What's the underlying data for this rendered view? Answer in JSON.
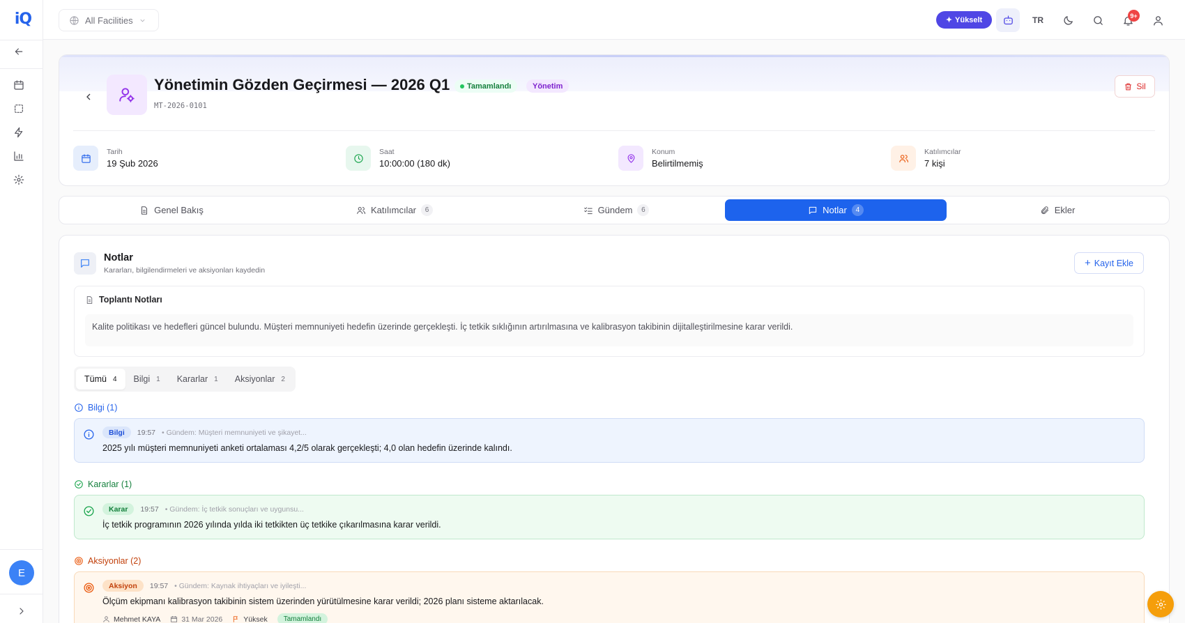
{
  "brand": {
    "logo_text": "iQ"
  },
  "topbar": {
    "facility_label": "All Facilities",
    "upgrade_label": "Yükselt",
    "language": "TR",
    "notifications_badge": "9+"
  },
  "sidebar": {
    "items": [
      "back-arrow-icon",
      "calendar-icon",
      "dashed-square-icon",
      "zap-icon",
      "bar-chart-icon",
      "settings-icon"
    ],
    "avatar_initial": "E"
  },
  "meeting": {
    "title": "Yönetimin Gözden Geçirmesi — 2026 Q1",
    "status_badge": "Tamamlandı",
    "category_badge": "Yönetim",
    "code": "MT-2026-0101",
    "delete_label": "Sil",
    "info": [
      {
        "label": "Tarih",
        "value": "19 Şub 2026",
        "icon": "calendar-icon",
        "bg": "#e6eefc",
        "color": "#2563eb"
      },
      {
        "label": "Saat",
        "value": "10:00:00 (180 dk)",
        "icon": "clock-icon",
        "bg": "#e7f7ee",
        "color": "#16a34a"
      },
      {
        "label": "Konum",
        "value": "Belirtilmemiş",
        "icon": "map-pin-icon",
        "bg": "#f3e8ff",
        "color": "#9333ea"
      },
      {
        "label": "Katılımcılar",
        "value": "7 kişi",
        "icon": "users-icon",
        "bg": "#fff1e6",
        "color": "#ea580c"
      }
    ]
  },
  "tabs": [
    {
      "label": "Genel Bakış",
      "count": "",
      "icon": "document-icon"
    },
    {
      "label": "Katılımcılar",
      "count": "6",
      "icon": "users-icon"
    },
    {
      "label": "Gündem",
      "count": "6",
      "icon": "list-check-icon"
    },
    {
      "label": "Notlar",
      "count": "4",
      "icon": "message-icon",
      "active": true
    },
    {
      "label": "Ekler",
      "count": "",
      "icon": "paperclip-icon"
    }
  ],
  "notes": {
    "title": "Notlar",
    "subtitle": "Kararları, bilgilendirmeleri ve aksiyonları kaydedin",
    "add_label": "Kayıt Ekle",
    "minutes_title": "Toplantı Notları",
    "minutes_text": "Kalite politikası ve hedefleri güncel bulundu. Müşteri memnuniyeti hedefin üzerinde gerçekleşti. İç tetkik sıklığının artırılmasına ve kalibrasyon takibinin dijitalleştirilmesine karar verildi.",
    "filters": [
      {
        "label": "Tümü",
        "count": "4",
        "active": true
      },
      {
        "label": "Bilgi",
        "count": "1"
      },
      {
        "label": "Kararlar",
        "count": "1"
      },
      {
        "label": "Aksiyonlar",
        "count": "2"
      }
    ],
    "sections": {
      "info": {
        "heading": "Bilgi (1)",
        "tag": "Bilgi",
        "time": "19:57",
        "agenda": "• Gündem: Müşteri memnuniyeti ve şikayet...",
        "text": "2025 yılı müşteri memnuniyeti anketi ortalaması 4,2/5 olarak gerçekleşti; 4,0 olan hedefin üzerinde kalındı."
      },
      "decisions": {
        "heading": "Kararlar (1)",
        "tag": "Karar",
        "time": "19:57",
        "agenda": "• Gündem: İç tetkik sonuçları ve uygunsu...",
        "text": "İç tetkik programının 2026 yılında yılda iki tetkikten üç tetkike çıkarılmasına karar verildi."
      },
      "actions": {
        "heading": "Aksiyonlar (2)",
        "tag": "Aksiyon",
        "time": "19:57",
        "agenda": "• Gündem: Kaynak ihtiyaçları ve iyileşti...",
        "text": "Ölçüm ekipmanı kalibrasyon takibinin sistem üzerinden yürütülmesine karar verildi; 2026 planı sisteme aktarılacak.",
        "owner": "Mehmet KAYA",
        "due_date": "31 Mar 2026",
        "priority": "Yüksek",
        "status": "Tamamlandı"
      }
    }
  },
  "colors": {
    "primary": "#1d63ed",
    "info": "#2563eb",
    "decision": "#16a34a",
    "action": "#ea580c",
    "danger": "#dc2626"
  }
}
